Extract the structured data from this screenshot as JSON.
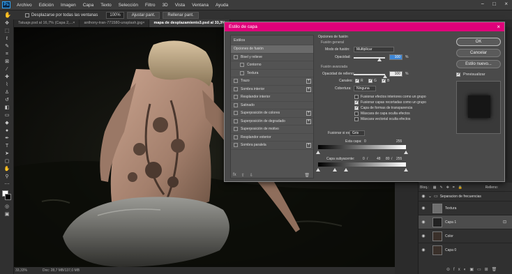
{
  "app": {
    "logo": "Ps",
    "menu": [
      "Archivo",
      "Edición",
      "Imagen",
      "Capa",
      "Texto",
      "Selección",
      "Filtro",
      "3D",
      "Vista",
      "Ventana",
      "Ayuda"
    ],
    "window_controls": [
      "−",
      "□",
      "×"
    ]
  },
  "options_bar": {
    "scroll_all": "Desplazarse por todas las ventanas",
    "zoom": "100%",
    "fit": "Ajustar pant.",
    "fill": "Rellenar pant."
  },
  "doc_tabs": [
    "Tatuaje.psd al 16,7% (Capa 2,...×",
    "anthony-tran-771580-unsplash.jpg×",
    "mapa de desplazamiento3.psd al 33,3%"
  ],
  "status": {
    "zoom": "33,33%",
    "doc": "Doc: 28,7 MB/137,0 MB"
  },
  "dialog": {
    "title": "Estilo de capa",
    "styles_header": "Estilos",
    "styles": [
      {
        "label": "Opciones de fusión",
        "check": false,
        "sub": false,
        "plus": false,
        "sel": true
      },
      {
        "label": "Bisel y relieve",
        "check": true,
        "sub": false,
        "plus": false,
        "sel": false
      },
      {
        "label": "Contorno",
        "check": true,
        "sub": true,
        "plus": false,
        "sel": false
      },
      {
        "label": "Textura",
        "check": true,
        "sub": true,
        "plus": false,
        "sel": false
      },
      {
        "label": "Trazo",
        "check": true,
        "sub": false,
        "plus": true,
        "sel": false
      },
      {
        "label": "Sombra interior",
        "check": true,
        "sub": false,
        "plus": true,
        "sel": false
      },
      {
        "label": "Resplandor interior",
        "check": true,
        "sub": false,
        "plus": false,
        "sel": false
      },
      {
        "label": "Satinado",
        "check": true,
        "sub": false,
        "plus": false,
        "sel": false
      },
      {
        "label": "Superposición de colores",
        "check": true,
        "sub": false,
        "plus": true,
        "sel": false
      },
      {
        "label": "Superposición de degradado",
        "check": true,
        "sub": false,
        "plus": true,
        "sel": false
      },
      {
        "label": "Superposición de motivo",
        "check": true,
        "sub": false,
        "plus": false,
        "sel": false
      },
      {
        "label": "Resplandor exterior",
        "check": true,
        "sub": false,
        "plus": false,
        "sel": false
      },
      {
        "label": "Sombra paralela",
        "check": true,
        "sub": false,
        "plus": true,
        "sel": false
      }
    ],
    "fx_label": "fx",
    "blend": {
      "section": "Opciones de fusión",
      "general": "Fusión general",
      "mode_label": "Modo de fusión:",
      "mode_value": "Multiplicar",
      "opacity_label": "Opacidad:",
      "opacity_value": "100",
      "opacity_pct": "%",
      "advanced": "Fusión avanzada",
      "fill_label": "Opacidad de relleno:",
      "fill_value": "100",
      "fill_pct": "%",
      "channels_label": "Canales:",
      "ch_r": "R",
      "ch_g": "G",
      "ch_b": "B",
      "knockout_label": "Cobertura:",
      "knockout_value": "Ninguna",
      "opts": [
        "Fusionar efectos interiores como un grupo",
        "Fusionar capas recortadas como un grupo",
        "Capa de formas de transparencia",
        "Máscara de capa oculta efectos",
        "Máscara vectorial oculta efectos"
      ],
      "opts_on": [
        false,
        true,
        true,
        false,
        false
      ],
      "blendif_label": "Fusionar si es:",
      "blendif_value": "Gris",
      "this_layer": "Esta capa:",
      "this_lo": "0",
      "this_hi": "255",
      "under_layer": "Capa subyacente:",
      "under_lo": "0",
      "under_slash1": "/",
      "under_v2": "48",
      "under_v3": "80",
      "under_slash2": "/",
      "under_hi": "255"
    },
    "buttons": {
      "ok": "OK",
      "cancel": "Cancelar",
      "new": "Estilo nuevo...",
      "preview": "Previsualizar"
    }
  },
  "layers": {
    "blend_label": "Bloq.:",
    "fill_label": "Relleno:",
    "items": [
      {
        "name": "Separacion de frecuencias",
        "group": true,
        "sel": false
      },
      {
        "name": "Textura",
        "group": false,
        "sel": false
      },
      {
        "name": "Capa 1",
        "group": false,
        "sel": true
      },
      {
        "name": "Color",
        "group": false,
        "sel": false
      },
      {
        "name": "Capa 0",
        "group": false,
        "sel": false
      }
    ]
  }
}
